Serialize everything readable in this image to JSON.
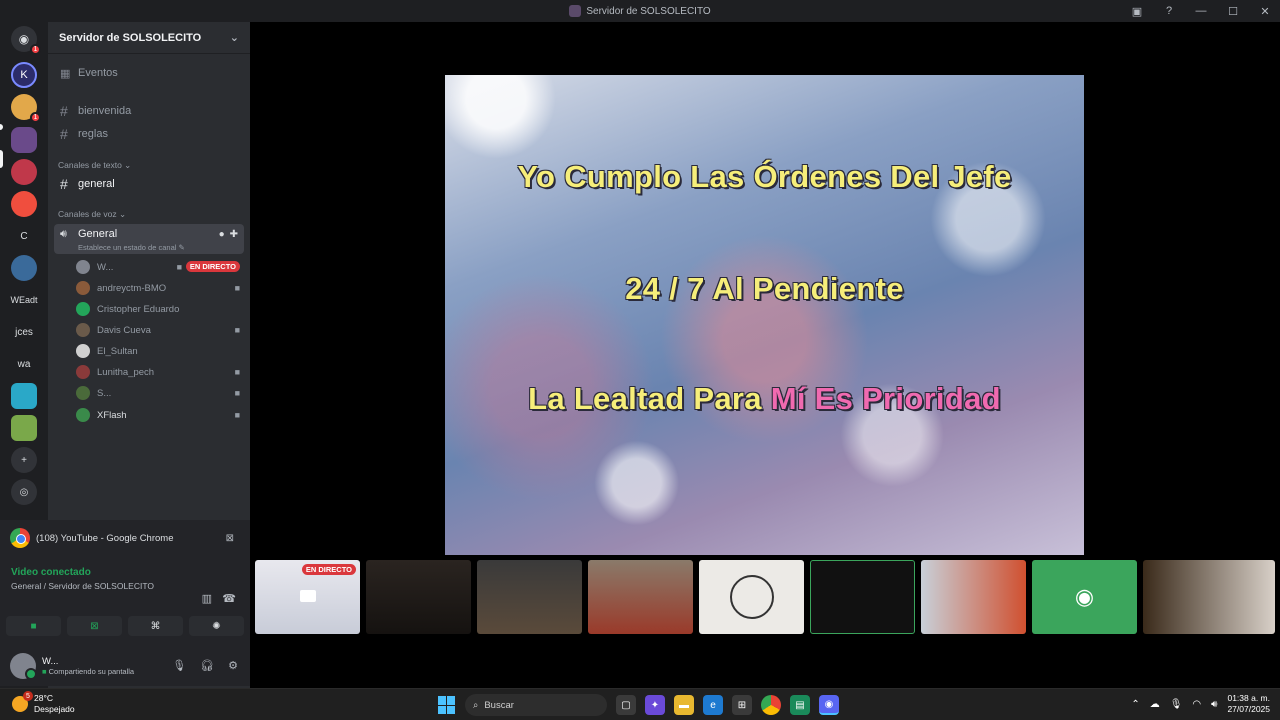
{
  "window": {
    "title": "Servidor de SOLSOLECITO"
  },
  "guilds": {
    "items": [
      {
        "label": "",
        "color": "#5865f2",
        "badge": "1"
      },
      {
        "label": "",
        "color": "#2c2c6a"
      },
      {
        "label": "",
        "color": "#e2a84a",
        "badge": "1"
      },
      {
        "label": "",
        "color": "#6a4a8a"
      },
      {
        "label": "",
        "color": "#c0384a"
      },
      {
        "label": "",
        "color": "#f04e3e"
      },
      {
        "label": "C",
        "color": "#1e1f22"
      },
      {
        "label": "",
        "color": "#3a6a9a"
      },
      {
        "label": "WEadt",
        "color": "#1e1f22"
      },
      {
        "label": "jces",
        "color": "#1e1f22"
      },
      {
        "label": "wa",
        "color": "#1e1f22"
      },
      {
        "label": "",
        "color": "#2aa8c8"
      },
      {
        "label": "",
        "color": "#7aa84a"
      }
    ]
  },
  "sidebar": {
    "server_name": "Servidor de SOLSOLECITO",
    "events": "Eventos",
    "top_channels": [
      "bienvenida",
      "reglas"
    ],
    "text_category": "Canales de texto",
    "text_channels": [
      "general"
    ],
    "voice_category": "Canales de voz",
    "voice_channel": {
      "name": "General",
      "status": "Establece un estado de canal"
    },
    "voice_users": [
      {
        "name": "W...",
        "live": "EN DIRECTO",
        "color": "#80848e"
      },
      {
        "name": "andreyctm-BMO",
        "color": "#8a5a3a"
      },
      {
        "name": "Cristopher Eduardo",
        "color": "#23a55a"
      },
      {
        "name": "Davis Cueva",
        "color": "#6a5a4a"
      },
      {
        "name": "El_Sultan",
        "color": "#d0d0d0"
      },
      {
        "name": "Lunitha_pech",
        "color": "#8a3a3a"
      },
      {
        "name": "S...",
        "color": "#4a6a3a"
      },
      {
        "name": "XFlash",
        "color": "#3a8a4a"
      }
    ]
  },
  "panel": {
    "activity": "(108) YouTube - Google Chrome",
    "video_connected": "Video conectado",
    "video_location": "General / Servidor de SOLSOLECITO",
    "user": {
      "name": "W...",
      "status": "Compartiendo su pantalla"
    }
  },
  "stage": {
    "line1": "Yo Cumplo Las Órdenes Del Jefe",
    "line2": "24 / 7 Al Pendiente",
    "line3a": "La Lealtad Para ",
    "line3b": "Mí Es Prioridad",
    "tile_live": "EN DIRECTO"
  },
  "taskbar": {
    "weather_temp": "28°C",
    "weather_desc": "Despejado",
    "weather_badge": "5",
    "search_placeholder": "Buscar",
    "time": "01:38 a. m.",
    "date": "27/07/2025"
  }
}
